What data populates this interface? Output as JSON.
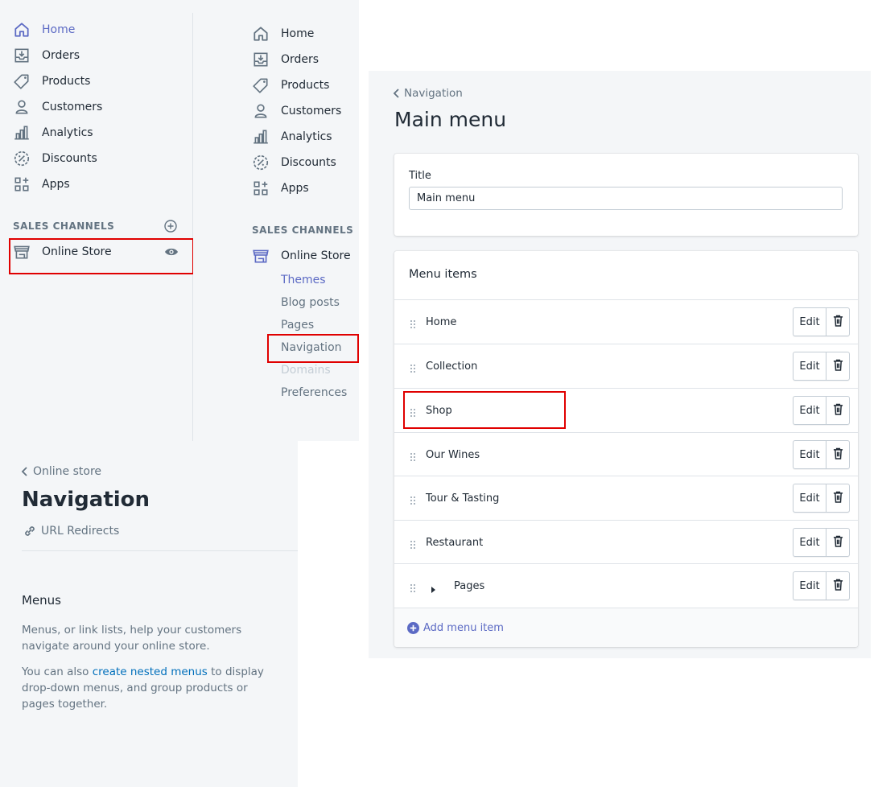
{
  "left_sidebar": {
    "items": [
      {
        "label": "Home",
        "icon": "home-icon",
        "active": true
      },
      {
        "label": "Orders",
        "icon": "orders-icon"
      },
      {
        "label": "Products",
        "icon": "tag-icon"
      },
      {
        "label": "Customers",
        "icon": "person-icon"
      },
      {
        "label": "Analytics",
        "icon": "chart-icon"
      },
      {
        "label": "Discounts",
        "icon": "discount-icon"
      },
      {
        "label": "Apps",
        "icon": "apps-icon"
      }
    ],
    "sales_channels_label": "SALES CHANNELS",
    "online_store_label": "Online Store"
  },
  "mid_sidebar": {
    "items": [
      {
        "label": "Home"
      },
      {
        "label": "Orders"
      },
      {
        "label": "Products"
      },
      {
        "label": "Customers"
      },
      {
        "label": "Analytics"
      },
      {
        "label": "Discounts"
      },
      {
        "label": "Apps"
      }
    ],
    "sales_channels_label": "SALES CHANNELS",
    "online_store_label": "Online Store",
    "sub_items": [
      {
        "label": "Themes"
      },
      {
        "label": "Blog posts"
      },
      {
        "label": "Pages"
      },
      {
        "label": "Navigation"
      },
      {
        "label": "Domains"
      },
      {
        "label": "Preferences"
      }
    ]
  },
  "nav_page": {
    "breadcrumb": "Online store",
    "title": "Navigation",
    "url_redirects": "URL Redirects",
    "menus_heading": "Menus",
    "menus_desc": "Menus, or link lists, help your customers navigate around your online store.",
    "nested_prefix": "You can also ",
    "nested_link": "create nested menus",
    "nested_suffix": " to display drop-down menus, and group products or pages together."
  },
  "main_menu": {
    "breadcrumb": "Navigation",
    "title": "Main menu",
    "title_label": "Title",
    "title_value": "Main menu",
    "menu_items_heading": "Menu items",
    "edit_label": "Edit",
    "items": [
      {
        "label": "Home"
      },
      {
        "label": "Collection"
      },
      {
        "label": "Shop"
      },
      {
        "label": "Our Wines"
      },
      {
        "label": "Tour & Tasting"
      },
      {
        "label": "Restaurant"
      },
      {
        "label": "Pages"
      }
    ],
    "add_menu_item": "Add menu item"
  },
  "colors": {
    "accent": "#5c6ac4",
    "highlight": "#e00000",
    "link": "#006fbb"
  }
}
